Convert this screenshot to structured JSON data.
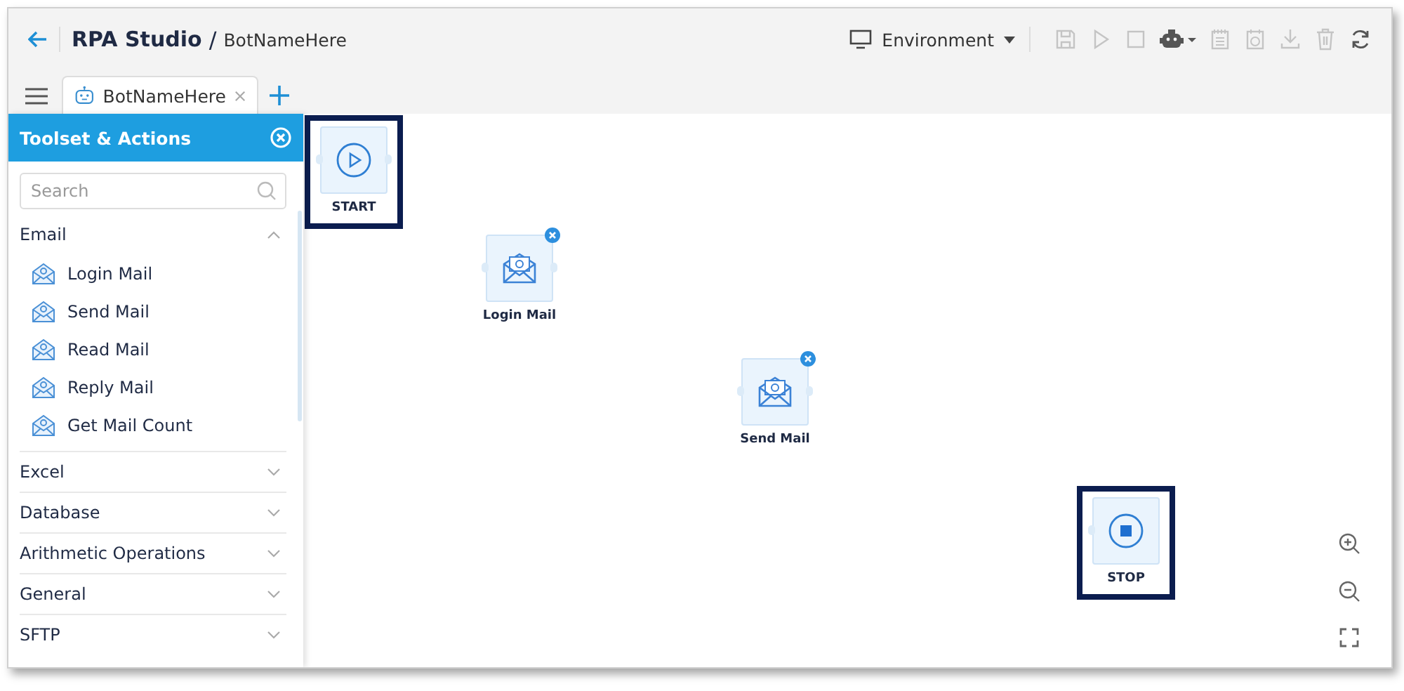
{
  "header": {
    "title": "RPA Studio",
    "separator": "/",
    "bot_name": "BotNameHere",
    "environment": "Environment",
    "toolbar": [
      {
        "kind": "save",
        "disabled": true
      },
      {
        "kind": "play",
        "disabled": true
      },
      {
        "kind": "stop",
        "disabled": true
      },
      {
        "kind": "robot",
        "disabled": false
      },
      {
        "kind": "calendar",
        "disabled": true
      },
      {
        "kind": "schedule",
        "disabled": true
      },
      {
        "kind": "download",
        "disabled": true
      },
      {
        "kind": "delete",
        "disabled": true
      },
      {
        "kind": "refresh",
        "disabled": false
      }
    ]
  },
  "tabs": [
    {
      "label": "BotNameHere",
      "selected": true
    }
  ],
  "sidebar": {
    "title": "Toolset & Actions",
    "search": {
      "placeholder": "Search"
    },
    "categories": [
      {
        "label": "Email",
        "expanded": true,
        "items": [
          "Login Mail",
          "Send Mail",
          "Read Mail",
          "Reply Mail",
          "Get Mail Count"
        ]
      },
      {
        "label": "Excel",
        "expanded": false
      },
      {
        "label": "Database",
        "expanded": false
      },
      {
        "label": "Arithmetic Operations",
        "expanded": false
      },
      {
        "label": "General",
        "expanded": false
      },
      {
        "label": "SFTP",
        "expanded": false
      }
    ]
  },
  "canvas": {
    "nodes": [
      {
        "kind": "start",
        "label": "START",
        "highlighted": true,
        "removable": false
      },
      {
        "kind": "action",
        "label": "Login Mail",
        "highlighted": false,
        "removable": true
      },
      {
        "kind": "action",
        "label": "Send Mail",
        "highlighted": false,
        "removable": true
      },
      {
        "kind": "stop",
        "label": "STOP",
        "highlighted": true,
        "removable": false
      }
    ]
  }
}
